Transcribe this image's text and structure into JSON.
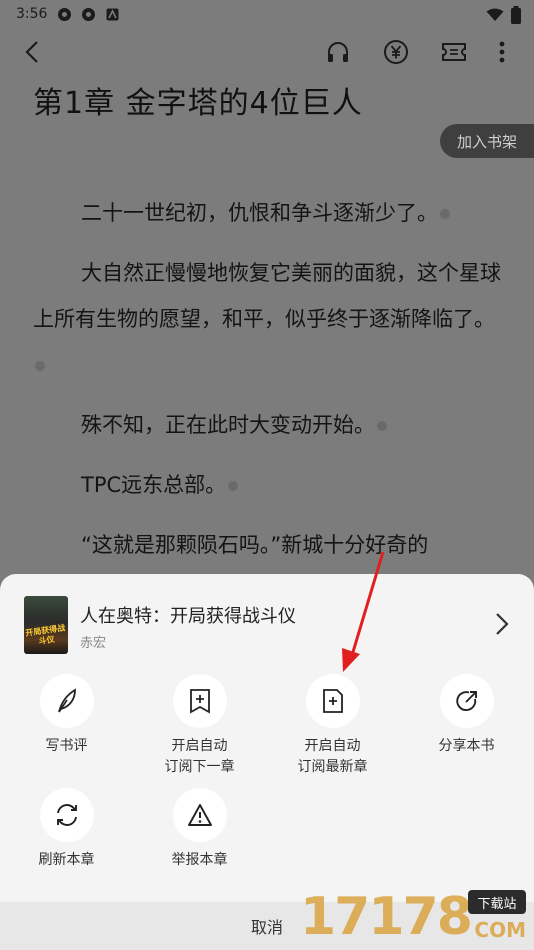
{
  "status_bar": {
    "time": "3:56"
  },
  "reader": {
    "chapter_title": "第1章 金字塔的4位巨人",
    "add_to_shelf": "加入书架",
    "paragraphs": [
      "二十一世纪初，仇恨和争斗逐渐少了。",
      "大自然正慢慢地恢复它美丽的面貌，这个星球上所有生物的愿望，和平，似乎终于逐渐降临了。",
      "殊不知，正在此时大变动开始。",
      "TPC远东总部。",
      "“这就是那颗陨石吗。”新城十分好奇的"
    ]
  },
  "sheet": {
    "book_title": "人在奥特：开局获得战斗仪",
    "book_author": "赤宏",
    "cover_text": "开局获得战斗仪",
    "actions": [
      {
        "label": "写书评",
        "icon": "quill-icon"
      },
      {
        "label": "开启自动订阅下一章",
        "line1": "开启自动",
        "line2": "订阅下一章",
        "icon": "bookmark-plus-icon"
      },
      {
        "label": "开启自动订阅最新章",
        "line1": "开启自动",
        "line2": "订阅最新章",
        "icon": "document-plus-icon"
      },
      {
        "label": "分享本书",
        "icon": "share-icon"
      },
      {
        "label": "刷新本章",
        "icon": "refresh-icon"
      },
      {
        "label": "举报本章",
        "icon": "warning-icon"
      }
    ],
    "cancel": "取消"
  },
  "watermark": {
    "digits": "17178",
    "site": "下载站",
    "com": "COM"
  },
  "colors": {
    "dim_overlay": "#7c7c7c",
    "sheet_bg": "#f4f4f4",
    "arrow": "#e02020",
    "watermark": "#d9a441"
  }
}
